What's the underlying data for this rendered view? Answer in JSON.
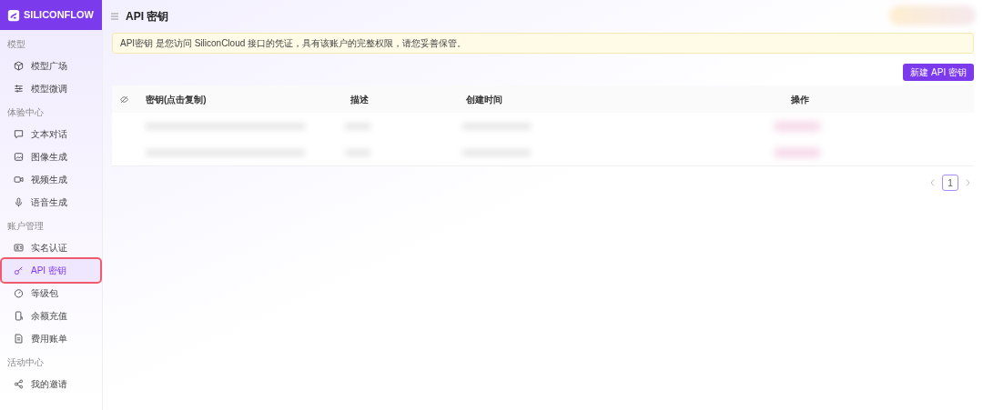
{
  "brand": {
    "name": "SILICONFLOW"
  },
  "header": {
    "title": "API 密钥"
  },
  "sidebar": {
    "sections": [
      {
        "title": "模型",
        "items": [
          {
            "label": "模型广场",
            "selected": false,
            "highlighted": false
          },
          {
            "label": "模型微调",
            "selected": false,
            "highlighted": false
          }
        ]
      },
      {
        "title": "体验中心",
        "items": [
          {
            "label": "文本对话",
            "selected": false,
            "highlighted": false
          },
          {
            "label": "图像生成",
            "selected": false,
            "highlighted": false
          },
          {
            "label": "视频生成",
            "selected": false,
            "highlighted": false
          },
          {
            "label": "语音生成",
            "selected": false,
            "highlighted": false
          }
        ]
      },
      {
        "title": "账户管理",
        "items": [
          {
            "label": "实名认证",
            "selected": false,
            "highlighted": false
          },
          {
            "label": "API 密钥",
            "selected": true,
            "highlighted": true
          },
          {
            "label": "等级包",
            "selected": false,
            "highlighted": false
          },
          {
            "label": "余额充值",
            "selected": false,
            "highlighted": false
          },
          {
            "label": "费用账单",
            "selected": false,
            "highlighted": false
          }
        ]
      },
      {
        "title": "活动中心",
        "items": [
          {
            "label": "我的邀请",
            "selected": false,
            "highlighted": false
          }
        ]
      }
    ]
  },
  "notice": {
    "text": "API密钥 是您访问 SiliconCloud 接口的凭证，具有该账户的完整权限，请您妥善保管。"
  },
  "new_button": {
    "label": "新建 API 密钥"
  },
  "table": {
    "columns": [
      "密钥(点击复制)",
      "描述",
      "创建时间",
      "操作"
    ]
  },
  "pagination": {
    "pages": [
      {
        "label": "1",
        "selected": true
      }
    ]
  }
}
